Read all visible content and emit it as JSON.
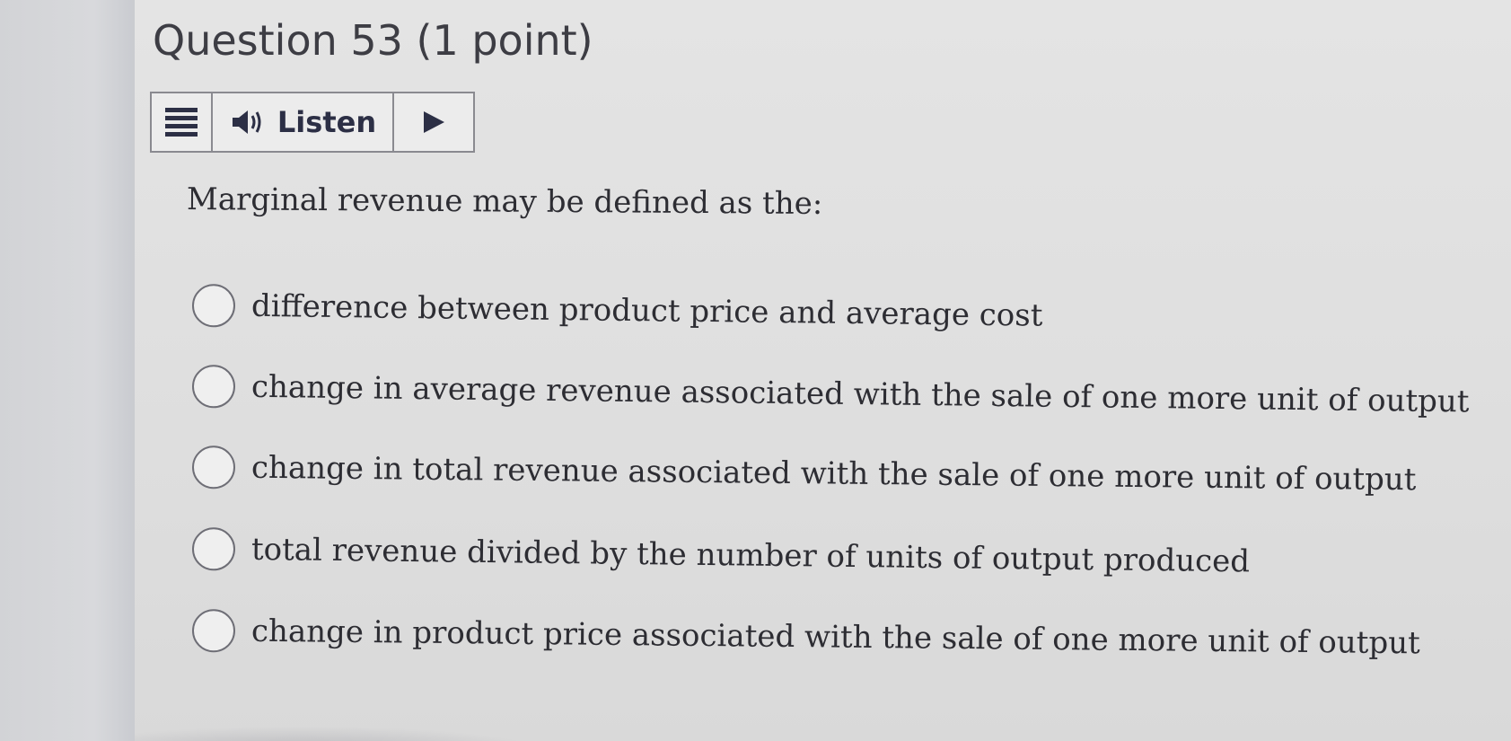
{
  "question": {
    "title": "Question 53 (1 point)",
    "listen_label": "Listen",
    "prompt": "Marginal revenue may be defined as the:",
    "options": [
      {
        "label": "difference between product price and average cost",
        "selected": false
      },
      {
        "label": "change in average revenue associated with the sale of one more unit of output",
        "selected": false
      },
      {
        "label": "change in total revenue associated with the sale of one more unit of output",
        "selected": false
      },
      {
        "label": "total revenue divided by the number of units of output produced",
        "selected": false
      },
      {
        "label": "change in product price associated with the sale of one more unit of output",
        "selected": false
      }
    ]
  },
  "icons": {
    "menu": "menu-icon",
    "speaker": "speaker-icon",
    "play": "play-icon"
  },
  "colors": {
    "text": "#2d2d33",
    "icon": "#2c2f45",
    "background": "#dedede"
  }
}
